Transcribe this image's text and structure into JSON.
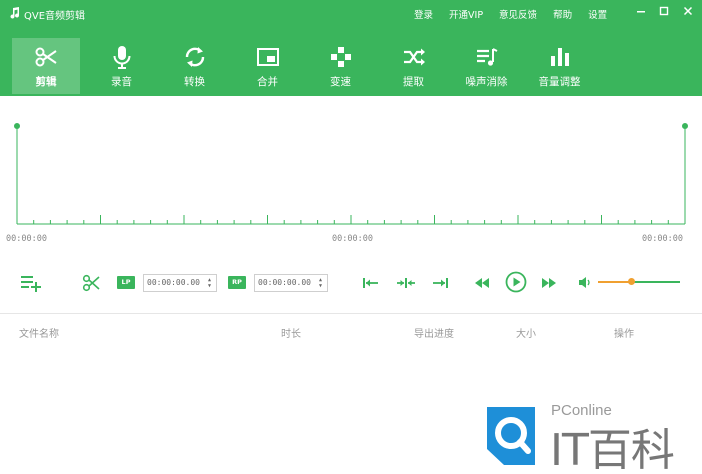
{
  "app": {
    "title": "QVE音频剪辑"
  },
  "top_links": [
    "登录",
    "开通VIP",
    "意见反馈",
    "帮助",
    "设置"
  ],
  "toolbar": [
    {
      "label": "剪辑",
      "icon": "scissors-icon",
      "active": true
    },
    {
      "label": "录音",
      "icon": "microphone-icon",
      "active": false
    },
    {
      "label": "转换",
      "icon": "convert-icon",
      "active": false
    },
    {
      "label": "合并",
      "icon": "merge-icon",
      "active": false
    },
    {
      "label": "变速",
      "icon": "speed-icon",
      "active": false
    },
    {
      "label": "提取",
      "icon": "extract-icon",
      "active": false
    },
    {
      "label": "噪声消除",
      "icon": "noise-removal-icon",
      "active": false
    },
    {
      "label": "音量调整",
      "icon": "volume-adjust-icon",
      "active": false
    }
  ],
  "timeline": {
    "start": "00:00:00",
    "middle": "00:00:00",
    "end": "00:00:00"
  },
  "controls": {
    "lp_label": "LP",
    "rp_label": "RP",
    "lp_value": "00:00:00.00",
    "rp_value": "00:00:00.00",
    "volume_level": 0.5
  },
  "file_list": {
    "columns": [
      "文件名称",
      "时长",
      "导出进度",
      "大小",
      "操作"
    ]
  },
  "watermark": {
    "brand": "PConline",
    "title": "IT百科"
  },
  "colors": {
    "accent": "#3ab55c",
    "volume": "#f0a030"
  }
}
